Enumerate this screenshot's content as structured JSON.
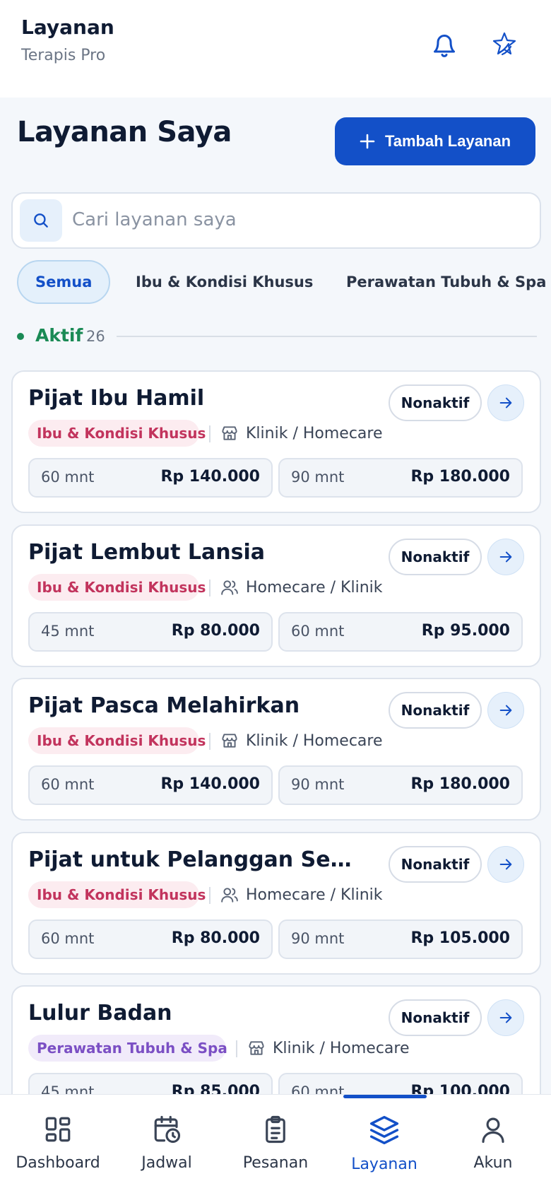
{
  "header": {
    "title": "Layanan",
    "subtitle": "Terapis Pro",
    "icons": [
      "bell-icon",
      "brand-logo-icon"
    ]
  },
  "page": {
    "title": "Layanan Saya",
    "add_button_label": "Tambah Layanan"
  },
  "search": {
    "placeholder": "Cari layanan saya"
  },
  "filters": [
    "Semua",
    "Ibu & Kondisi Khusus",
    "Perawatan Tubuh & Spa"
  ],
  "section": {
    "label": "Aktif",
    "count": "26"
  },
  "services": [
    {
      "name": "Pijat Ibu Hamil",
      "category": "Ibu & Kondisi Khusus",
      "mode": "Klinik / Homecare",
      "mode_icon": "store-icon",
      "toggle_label": "Nonaktif",
      "prices": [
        {
          "duration": "60 mnt",
          "price": "Rp 140.000"
        },
        {
          "duration": "90 mnt",
          "price": "Rp 180.000"
        }
      ]
    },
    {
      "name": "Pijat Lembut Lansia",
      "category": "Ibu & Kondisi Khusus",
      "mode": "Homecare / Klinik",
      "mode_icon": "users-icon",
      "toggle_label": "Nonaktif",
      "prices": [
        {
          "duration": "45 mnt",
          "price": "Rp 80.000"
        },
        {
          "duration": "60 mnt",
          "price": "Rp 95.000"
        }
      ]
    },
    {
      "name": "Pijat Pasca Melahirkan",
      "category": "Ibu & Kondisi Khusus",
      "mode": "Klinik / Homecare",
      "mode_icon": "store-icon",
      "toggle_label": "Nonaktif",
      "prices": [
        {
          "duration": "60 mnt",
          "price": "Rp 140.000"
        },
        {
          "duration": "90 mnt",
          "price": "Rp 180.000"
        }
      ]
    },
    {
      "name": "Pijat untuk Pelanggan Sensiti…",
      "category": "Ibu & Kondisi Khusus",
      "mode": "Homecare / Klinik",
      "mode_icon": "users-icon",
      "toggle_label": "Nonaktif",
      "prices": [
        {
          "duration": "60 mnt",
          "price": "Rp 80.000"
        },
        {
          "duration": "90 mnt",
          "price": "Rp 105.000"
        }
      ]
    },
    {
      "name": "Lulur Badan",
      "category": "Perawatan Tubuh & Spa",
      "mode": "Klinik / Homecare",
      "mode_icon": "store-icon",
      "toggle_label": "Nonaktif",
      "prices": [
        {
          "duration": "45 mnt",
          "price": "Rp 85.000"
        },
        {
          "duration": "60 mnt",
          "price": "Rp 100.000"
        }
      ]
    }
  ],
  "nav": [
    {
      "label": "Dashboard",
      "icon": "dashboard-icon",
      "active": false
    },
    {
      "label": "Jadwal",
      "icon": "calendar-clock-icon",
      "active": false
    },
    {
      "label": "Pesanan",
      "icon": "clipboard-icon",
      "active": false
    },
    {
      "label": "Layanan",
      "icon": "layers-icon",
      "active": true
    },
    {
      "label": "Akun",
      "icon": "user-icon",
      "active": false
    }
  ],
  "colors": {
    "primary": "#1350c8",
    "active_green": "#1a8a55",
    "pink_tag": "#c2345d",
    "purple_tag": "#7b4fc4"
  }
}
